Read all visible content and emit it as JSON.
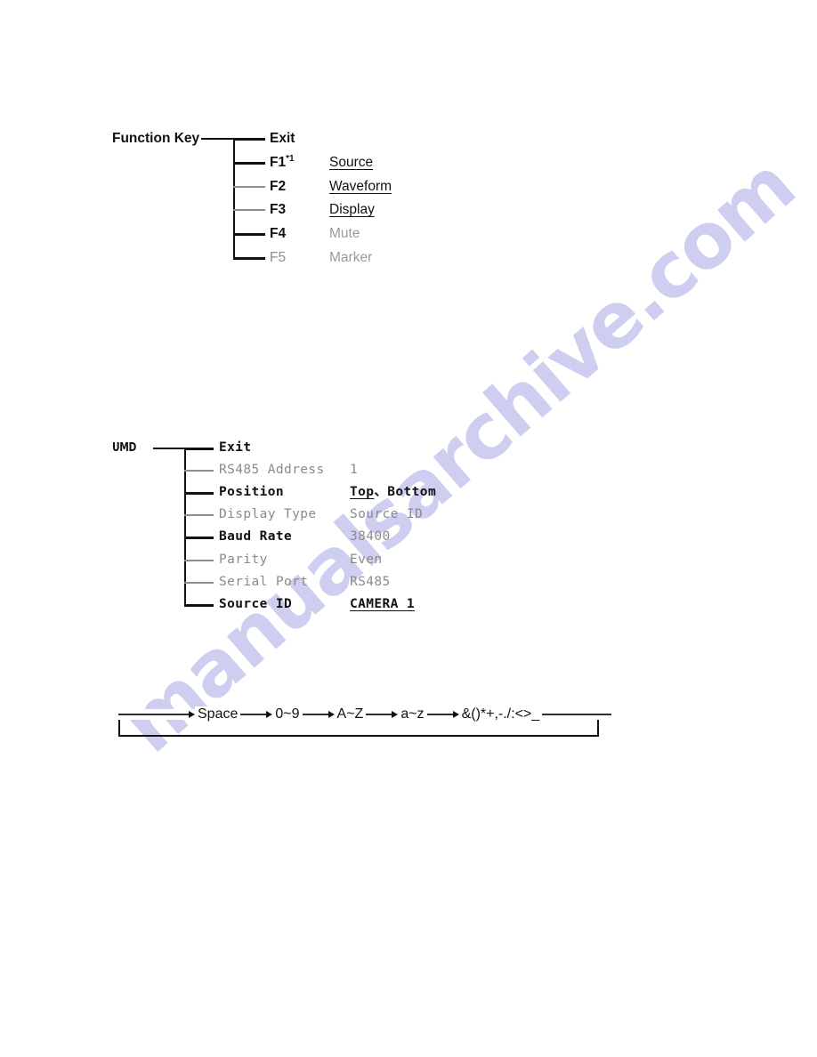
{
  "page": {
    "background": "#ffffff",
    "watermark_text": "manualsarchive.com",
    "watermark_color": "#ccccf0",
    "ink_color": "#111111",
    "muted_color": "#8a8a8a"
  },
  "function_key_menu": {
    "root_label": "Function Key",
    "rows": [
      {
        "key": "Exit",
        "key_sup": "",
        "key_muted": false,
        "value": "",
        "value_underlined": false,
        "value_muted": false,
        "branch_muted": false
      },
      {
        "key": "F1",
        "key_sup": "*1",
        "key_muted": false,
        "value": "Source",
        "value_underlined": true,
        "value_muted": false,
        "branch_muted": false
      },
      {
        "key": "F2",
        "key_sup": "",
        "key_muted": false,
        "value": "Waveform",
        "value_underlined": true,
        "value_muted": false,
        "branch_muted": true
      },
      {
        "key": "F3",
        "key_sup": "",
        "key_muted": false,
        "value": "Display",
        "value_underlined": true,
        "value_muted": false,
        "branch_muted": true
      },
      {
        "key": "F4",
        "key_sup": "",
        "key_muted": false,
        "value": "Mute",
        "value_underlined": false,
        "value_muted": true,
        "branch_muted": false
      },
      {
        "key": "F5",
        "key_sup": "",
        "key_muted": true,
        "value": "Marker",
        "value_underlined": false,
        "value_muted": true,
        "branch_muted": false
      }
    ]
  },
  "umd_menu": {
    "root_label": "UMD",
    "rows": [
      {
        "label": "Exit",
        "label_muted": false,
        "value": "",
        "value_underline_part": "",
        "value_rest": "",
        "value_muted": false
      },
      {
        "label": "RS485 Address",
        "label_muted": true,
        "value": "1",
        "value_underline_part": "",
        "value_rest": "1",
        "value_muted": true
      },
      {
        "label": "Position",
        "label_muted": false,
        "value": "Top、Bottom",
        "value_underline_part": "Top",
        "value_rest": "、Bottom",
        "value_muted": false
      },
      {
        "label": "Display Type",
        "label_muted": true,
        "value": "Source ID",
        "value_underline_part": "",
        "value_rest": "Source ID",
        "value_muted": true
      },
      {
        "label": "Baud Rate",
        "label_muted": false,
        "value": "38400",
        "value_underline_part": "",
        "value_rest": "38400",
        "value_muted": true
      },
      {
        "label": "Parity",
        "label_muted": true,
        "value": "Even",
        "value_underline_part": "",
        "value_rest": "Even",
        "value_muted": true
      },
      {
        "label": "Serial Port",
        "label_muted": true,
        "value": "RS485",
        "value_underline_part": "",
        "value_rest": "RS485",
        "value_muted": true
      },
      {
        "label": "Source ID",
        "label_muted": false,
        "value": "CAMERA  1",
        "value_underline_part": "CAMERA  1",
        "value_rest": "",
        "value_muted": false
      }
    ]
  },
  "charset_flow": {
    "items": [
      "Space",
      "0~9",
      "A~Z",
      "a~z",
      "&()*+,-./:<>_"
    ]
  }
}
